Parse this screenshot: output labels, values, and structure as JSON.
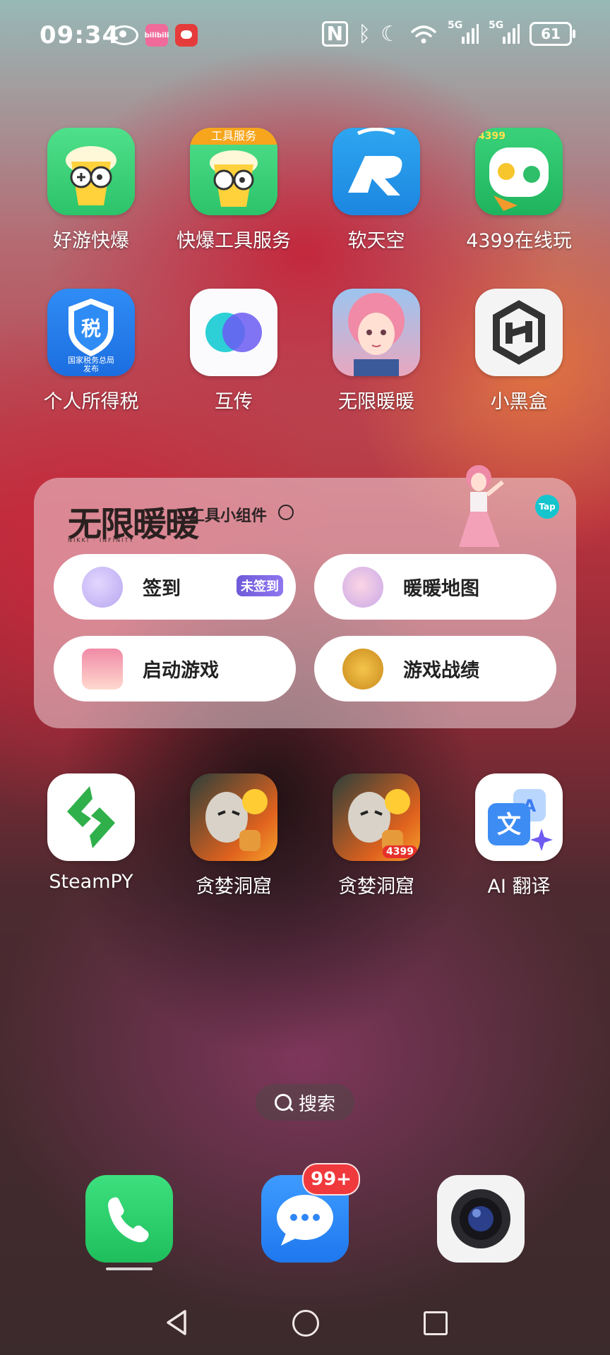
{
  "status_bar": {
    "time": "09:34",
    "app1_label": "bilibili",
    "net_5g_1": "5G",
    "net_5g_2": "5G",
    "battery": "61"
  },
  "apps": [
    {
      "label": "好游快爆",
      "icon": "haoyou-kuaibao-icon"
    },
    {
      "label": "快爆工具服务",
      "icon": "kuaibao-tools-icon",
      "tag": "工具服务"
    },
    {
      "label": "软天空",
      "icon": "ruantiankong-icon"
    },
    {
      "label": "4399在线玩",
      "icon": "4399-online-icon",
      "tag": "4399"
    },
    {
      "label": "个人所得税",
      "icon": "personal-tax-icon",
      "glyph": "税",
      "caption": "国家税务总局\n发布"
    },
    {
      "label": "互传",
      "icon": "share-transfer-icon"
    },
    {
      "label": "无限暖暖",
      "icon": "infinity-nikki-icon"
    },
    {
      "label": "小黑盒",
      "icon": "xiaoheihe-icon"
    },
    {
      "label": "SteamPY",
      "icon": "steampy-icon"
    },
    {
      "label": "贪婪洞窟",
      "icon": "greedy-cave-icon"
    },
    {
      "label": "贪婪洞窟",
      "icon": "greedy-cave-4399-icon",
      "tag": "4399"
    },
    {
      "label": "AI 翻译",
      "icon": "ai-translate-icon",
      "glyph": "文"
    }
  ],
  "widget": {
    "logo": "无限暖暖",
    "logo_sub": "NIKKI · INFINITY",
    "title": "工具小组件",
    "tap": "Tap",
    "buttons": [
      {
        "label": "签到",
        "badge": "未签到"
      },
      {
        "label": "暖暖地图"
      },
      {
        "label": "启动游戏"
      },
      {
        "label": "游戏战绩"
      }
    ]
  },
  "search": {
    "label": "搜索"
  },
  "dock": {
    "messages_badge": "99+"
  },
  "colors": {
    "phone_green": "#23d46b",
    "messages_blue": "#2f86f5",
    "badge_red": "#f0393c",
    "tap_cyan": "#15c5ce"
  }
}
